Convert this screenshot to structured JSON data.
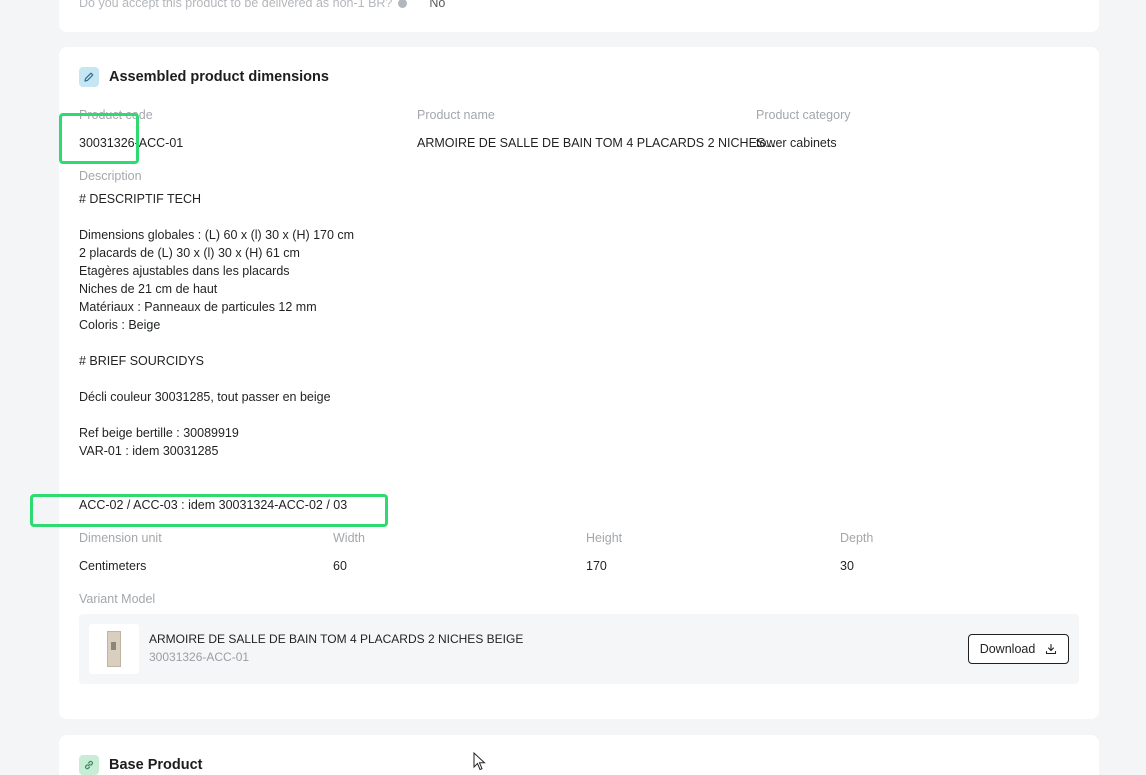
{
  "top_card": {
    "question": "Do you accept this product to be delivered as non-1 BR?",
    "answer": "No"
  },
  "assembled": {
    "title": "Assembled product dimensions",
    "icon": "pencil-icon",
    "product_code_label": "Product code",
    "product_code": "30031326-ACC-01",
    "product_name_label": "Product name",
    "product_name": "ARMOIRE DE SALLE DE BAIN TOM 4 PLACARDS 2 NICHES...",
    "product_category_label": "Product category",
    "product_category": "tower cabinets",
    "description_label": "Description",
    "description_lines": [
      "# DESCRIPTIF TECH",
      "",
      "Dimensions globales : (L) 60 x (l) 30 x (H) 170 cm",
      "2 placards de (L) 30 x (l) 30 x (H) 61 cm",
      "Etagères ajustables dans les placards",
      "Niches de 21 cm de haut",
      "Matériaux : Panneaux de particules 12 mm",
      "Coloris : Beige",
      "",
      "# BRIEF SOURCIDYS",
      "",
      "Décli couleur 30031285, tout passer en beige",
      "",
      "Ref beige bertille : 30089919",
      "VAR-01 : idem 30031285",
      "",
      "",
      "ACC-02 / ACC-03 : idem 30031324-ACC-02 / 03"
    ],
    "dimension_unit_label": "Dimension unit",
    "dimension_unit": "Centimeters",
    "width_label": "Width",
    "width": "60",
    "height_label": "Height",
    "height": "170",
    "depth_label": "Depth",
    "depth": "30",
    "variant_model_label": "Variant Model",
    "variant": {
      "name": "ARMOIRE DE SALLE DE BAIN TOM 4 PLACARDS 2 NICHES BEIGE",
      "code": "30031326-ACC-01",
      "download_label": "Download"
    }
  },
  "base_product": {
    "title": "Base Product",
    "icon": "link-icon"
  },
  "colors": {
    "highlight": "#2ddb71",
    "assembled_icon_bg": "#c7e6f3",
    "base_icon_bg": "#c9ecd7"
  }
}
